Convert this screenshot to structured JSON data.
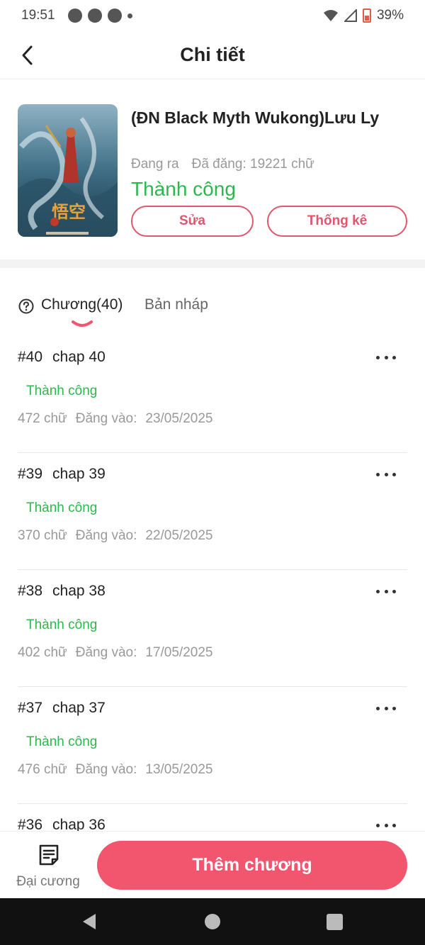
{
  "status_bar": {
    "time": "19:51",
    "battery": "39%"
  },
  "header": {
    "title": "Chi tiết"
  },
  "book": {
    "title": "(ĐN Black Myth Wukong)Lưu Ly",
    "publish_state": "Đang ra",
    "word_count_text": "Đã đăng: 19221 chữ",
    "status": "Thành công",
    "edit_label": "Sửa",
    "stats_label": "Thống kê"
  },
  "tabs": {
    "chapters_label": "Chương(40)",
    "drafts_label": "Bản nháp"
  },
  "chapters": [
    {
      "number": "#40",
      "title": "chap 40",
      "status": "Thành công",
      "words": "472 chữ",
      "posted_label": "Đăng vào:",
      "date": "23/05/2025"
    },
    {
      "number": "#39",
      "title": "chap 39",
      "status": "Thành công",
      "words": "370 chữ",
      "posted_label": "Đăng vào:",
      "date": "22/05/2025"
    },
    {
      "number": "#38",
      "title": "chap 38",
      "status": "Thành công",
      "words": "402 chữ",
      "posted_label": "Đăng vào:",
      "date": "17/05/2025"
    },
    {
      "number": "#37",
      "title": "chap 37",
      "status": "Thành công",
      "words": "476 chữ",
      "posted_label": "Đăng vào:",
      "date": "13/05/2025"
    },
    {
      "number": "#36",
      "title": "chap 36",
      "status": "",
      "words": "",
      "posted_label": "",
      "date": ""
    }
  ],
  "bottom": {
    "outline_label": "Đại cương",
    "add_chapter_label": "Thêm chương"
  },
  "colors": {
    "success": "#2db84b",
    "accent": "#f2566f",
    "accent_outline": "#e0566e"
  },
  "icons": [
    "back-arrow-icon",
    "help-icon",
    "more-icon",
    "outline-doc-icon",
    "nav-back-icon",
    "nav-home-icon",
    "nav-recent-icon"
  ]
}
